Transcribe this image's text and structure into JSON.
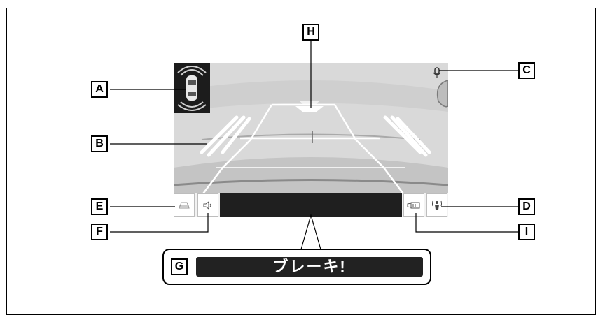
{
  "callouts": {
    "a": "A",
    "b": "B",
    "c": "C",
    "d": "D",
    "e": "E",
    "f": "F",
    "g": "G",
    "h": "H",
    "i": "I"
  },
  "warning": {
    "text": "ブレーキ!"
  },
  "icons": {
    "e": "road-lane-icon",
    "f": "speaker-icon",
    "i": "camera-view-icon",
    "d": "sensor-person-icon",
    "c": "microphone-icon"
  },
  "colors": {
    "camera_bg": "#d6d6d6",
    "guide_line": "#ffffff",
    "dark_panel": "#1f1f1f"
  }
}
